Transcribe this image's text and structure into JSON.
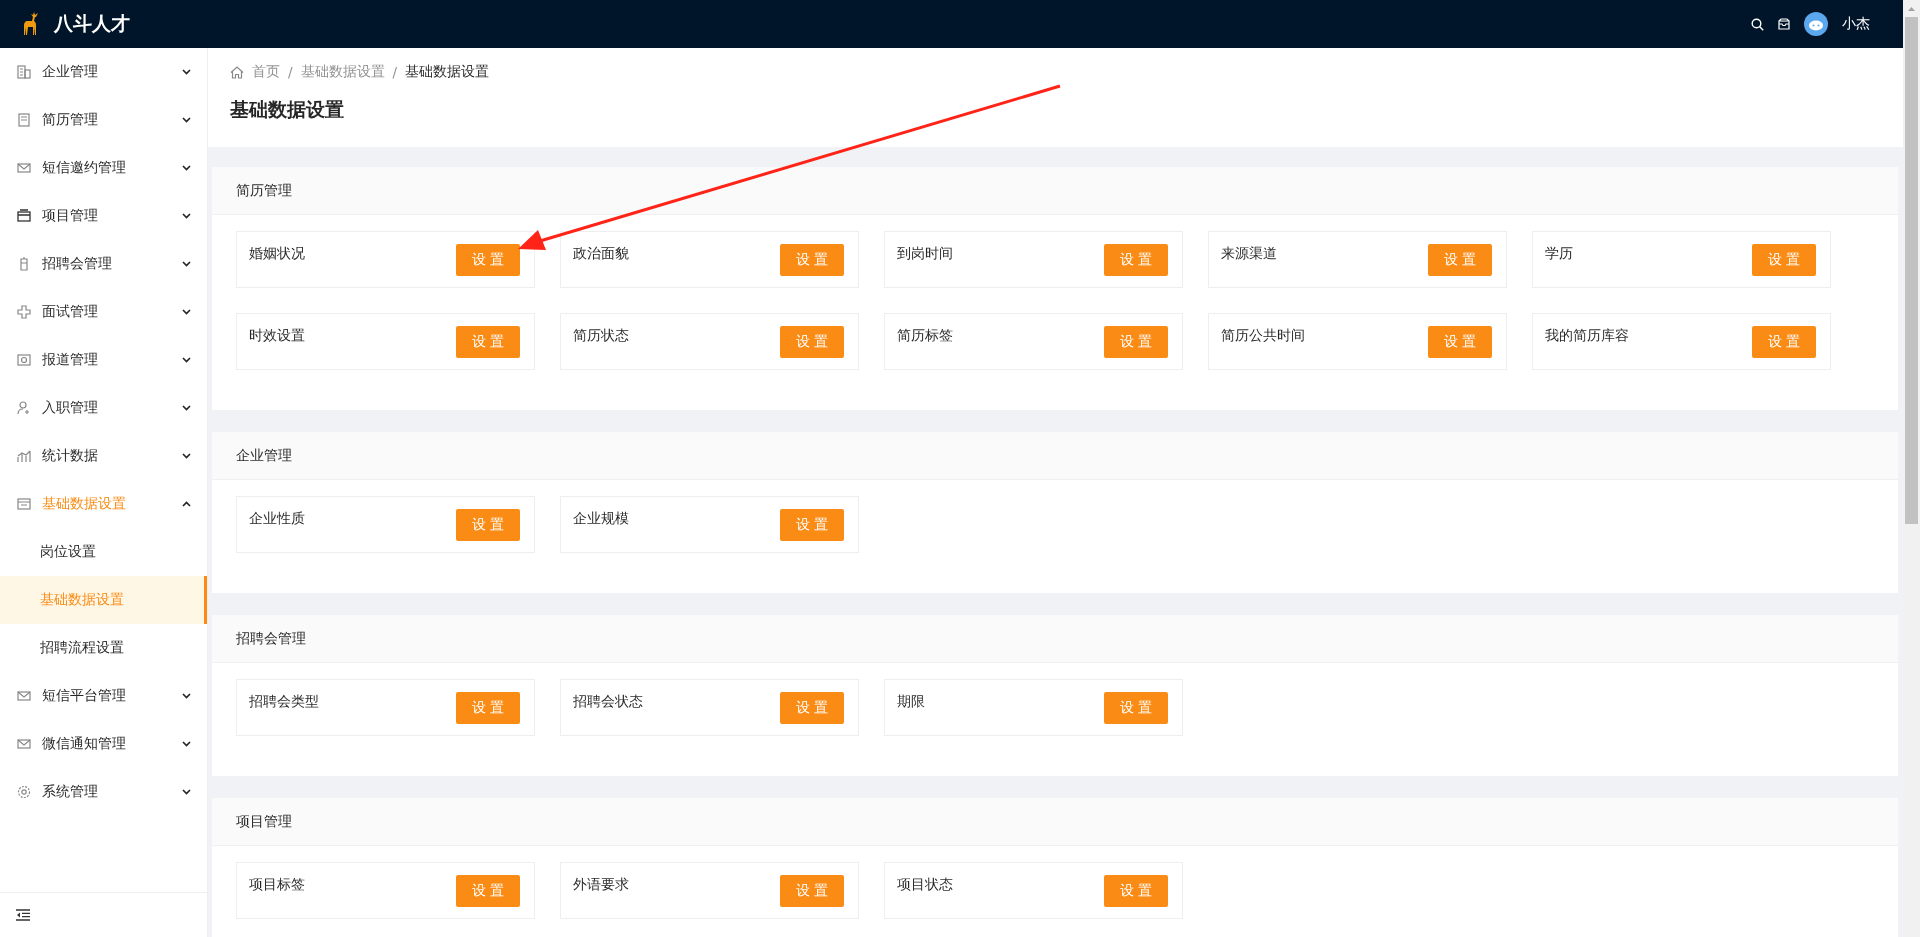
{
  "top_bar": {
    "brand": "八斗人才",
    "user_name": "小杰"
  },
  "sidebar": {
    "items": [
      {
        "label": "企业管理",
        "expanded": false
      },
      {
        "label": "简历管理",
        "expanded": false
      },
      {
        "label": "短信邀约管理",
        "expanded": false
      },
      {
        "label": "项目管理",
        "expanded": false
      },
      {
        "label": "招聘会管理",
        "expanded": false
      },
      {
        "label": "面试管理",
        "expanded": false
      },
      {
        "label": "报道管理",
        "expanded": false
      },
      {
        "label": "入职管理",
        "expanded": false
      },
      {
        "label": "统计数据",
        "expanded": false
      },
      {
        "label": "基础数据设置",
        "expanded": true,
        "children": [
          {
            "label": "岗位设置",
            "selected": false
          },
          {
            "label": "基础数据设置",
            "selected": true
          },
          {
            "label": "招聘流程设置",
            "selected": false
          }
        ]
      },
      {
        "label": "短信平台管理",
        "expanded": false
      },
      {
        "label": "微信通知管理",
        "expanded": false
      },
      {
        "label": "系统管理",
        "expanded": false
      }
    ]
  },
  "breadcrumb": [
    "首页",
    "基础数据设置",
    "基础数据设置"
  ],
  "breadcrumb_separator": "/",
  "page_title": "基础数据设置",
  "sections": [
    {
      "title": "简历管理",
      "items": [
        {
          "label": "婚姻状况",
          "button": "设置"
        },
        {
          "label": "政治面貌",
          "button": "设置"
        },
        {
          "label": "到岗时间",
          "button": "设置"
        },
        {
          "label": "来源渠道",
          "button": "设置"
        },
        {
          "label": "学历",
          "button": "设置"
        },
        {
          "label": "时效设置",
          "button": "设置"
        },
        {
          "label": "简历状态",
          "button": "设置"
        },
        {
          "label": "简历标签",
          "button": "设置"
        },
        {
          "label": "简历公共时间",
          "button": "设置"
        },
        {
          "label": "我的简历库容",
          "button": "设置"
        }
      ]
    },
    {
      "title": "企业管理",
      "items": [
        {
          "label": "企业性质",
          "button": "设置"
        },
        {
          "label": "企业规模",
          "button": "设置"
        }
      ]
    },
    {
      "title": "招聘会管理",
      "items": [
        {
          "label": "招聘会类型",
          "button": "设置"
        },
        {
          "label": "招聘会状态",
          "button": "设置"
        },
        {
          "label": "期限",
          "button": "设置"
        }
      ]
    },
    {
      "title": "项目管理",
      "items": [
        {
          "label": "项目标签",
          "button": "设置"
        },
        {
          "label": "外语要求",
          "button": "设置"
        },
        {
          "label": "项目状态",
          "button": "设置"
        }
      ]
    }
  ]
}
